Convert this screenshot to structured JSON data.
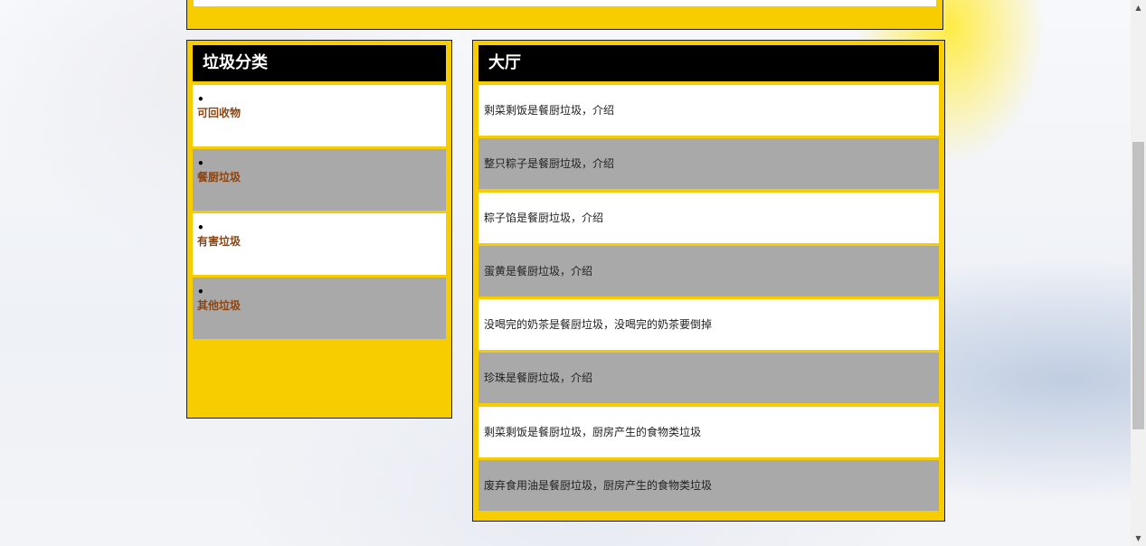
{
  "categories": {
    "title": "垃圾分类",
    "bullet": "•",
    "items": [
      {
        "label": "可回收物"
      },
      {
        "label": "餐厨垃圾"
      },
      {
        "label": "有害垃圾"
      },
      {
        "label": "其他垃圾"
      }
    ]
  },
  "hall": {
    "title": "大厅",
    "items": [
      {
        "text": "剩菜剩饭是餐厨垃圾，介绍"
      },
      {
        "text": "整只粽子是餐厨垃圾，介绍"
      },
      {
        "text": "粽子馅是餐厨垃圾，介绍"
      },
      {
        "text": "蛋黄是餐厨垃圾，介绍"
      },
      {
        "text": "没喝完的奶茶是餐厨垃圾，没喝完的奶茶要倒掉"
      },
      {
        "text": "珍珠是餐厨垃圾，介绍"
      },
      {
        "text": "剩菜剩饭是餐厨垃圾，厨房产生的食物类垃圾"
      },
      {
        "text": "废弃食用油是餐厨垃圾，厨房产生的食物类垃圾"
      }
    ]
  },
  "scrollbar": {
    "up_icon": "▲",
    "down_icon": "▼"
  },
  "colors": {
    "panel_bg": "#f7cd00",
    "header_bg": "#000000",
    "row_alt": "#a9a9a9",
    "category_label": "#8b4513"
  }
}
